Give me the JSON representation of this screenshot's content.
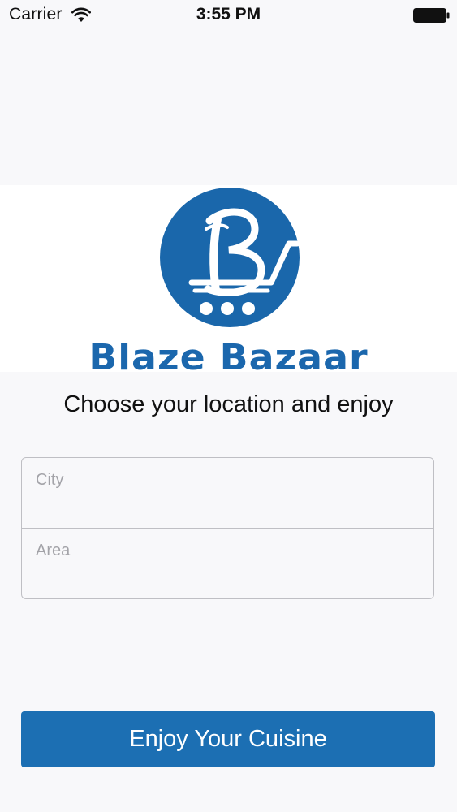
{
  "status_bar": {
    "carrier": "Carrier",
    "time": "3:55 PM",
    "icons": [
      "wifi-icon",
      "battery-icon"
    ]
  },
  "brand": {
    "name": "Blaze Bazaar",
    "logo_icon": "blaze-bazaar-logo",
    "color": "#1b67ad"
  },
  "heading": "Choose your location and enjoy",
  "form": {
    "city": {
      "placeholder": "City",
      "value": ""
    },
    "area": {
      "placeholder": "Area",
      "value": ""
    }
  },
  "cta": {
    "label": "Enjoy Your Cuisine",
    "color": "#1c6fb3"
  }
}
